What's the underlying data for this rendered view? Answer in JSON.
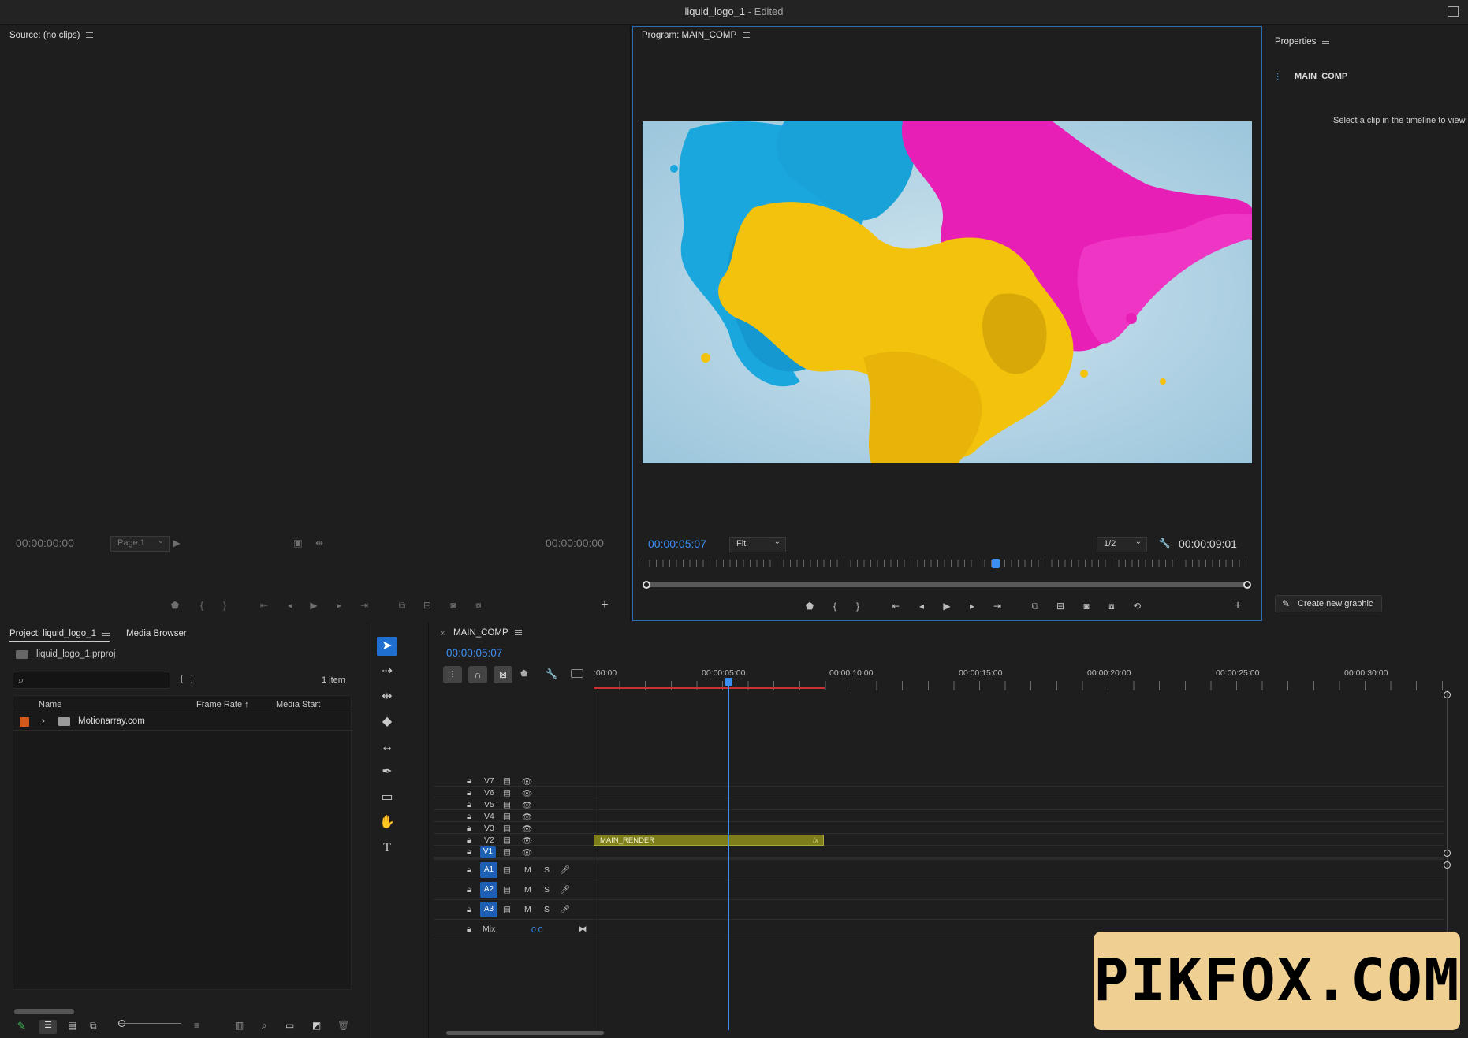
{
  "window": {
    "title": "liquid_logo_1",
    "status": "- Edited"
  },
  "source_monitor": {
    "title": "Source: (no clips)",
    "timecode_in": "00:00:00:00",
    "timecode_out": "00:00:00:00",
    "page_select": "Page 1"
  },
  "program_monitor": {
    "title": "Program: MAIN_COMP",
    "timecode": "00:00:05:07",
    "zoom": "Fit",
    "resolution": "1/2",
    "duration": "00:00:09:01",
    "playhead_fraction": 0.58
  },
  "properties": {
    "title": "Properties",
    "sequence_name": "MAIN_COMP",
    "hint": "Select a clip in the timeline to view",
    "create_button": "Create new graphic"
  },
  "project": {
    "tab_project": "Project: liquid_logo_1",
    "tab_media_browser": "Media Browser",
    "file": "liquid_logo_1.prproj",
    "item_count": "1 item",
    "search_placeholder": "",
    "columns": [
      "Name",
      "Frame Rate",
      "Media Start"
    ],
    "items": [
      {
        "name": "Motionarray.com",
        "color": "#d2591b"
      }
    ]
  },
  "timeline": {
    "title": "MAIN_COMP",
    "timecode": "00:00:05:07",
    "ruler_labels": [
      ":00:00",
      "00:00:05:00",
      "00:00:10:00",
      "00:00:15:00",
      "00:00:20:00",
      "00:00:25:00",
      "00:00:30:00"
    ],
    "video_tracks": [
      "V7",
      "V6",
      "V5",
      "V4",
      "V3",
      "V2",
      "V1"
    ],
    "audio_tracks": [
      "A1",
      "A2",
      "A3"
    ],
    "mute_label": "M",
    "solo_label": "S",
    "mix_label": "Mix",
    "mix_value": "0.0",
    "clip": {
      "name": "MAIN_RENDER",
      "fx": "fx"
    }
  },
  "watermark": "PIKFOX.COM",
  "colors": {
    "accent": "#2d8ceb",
    "clip": "#8b8b1c",
    "work_area": "#c83232"
  }
}
